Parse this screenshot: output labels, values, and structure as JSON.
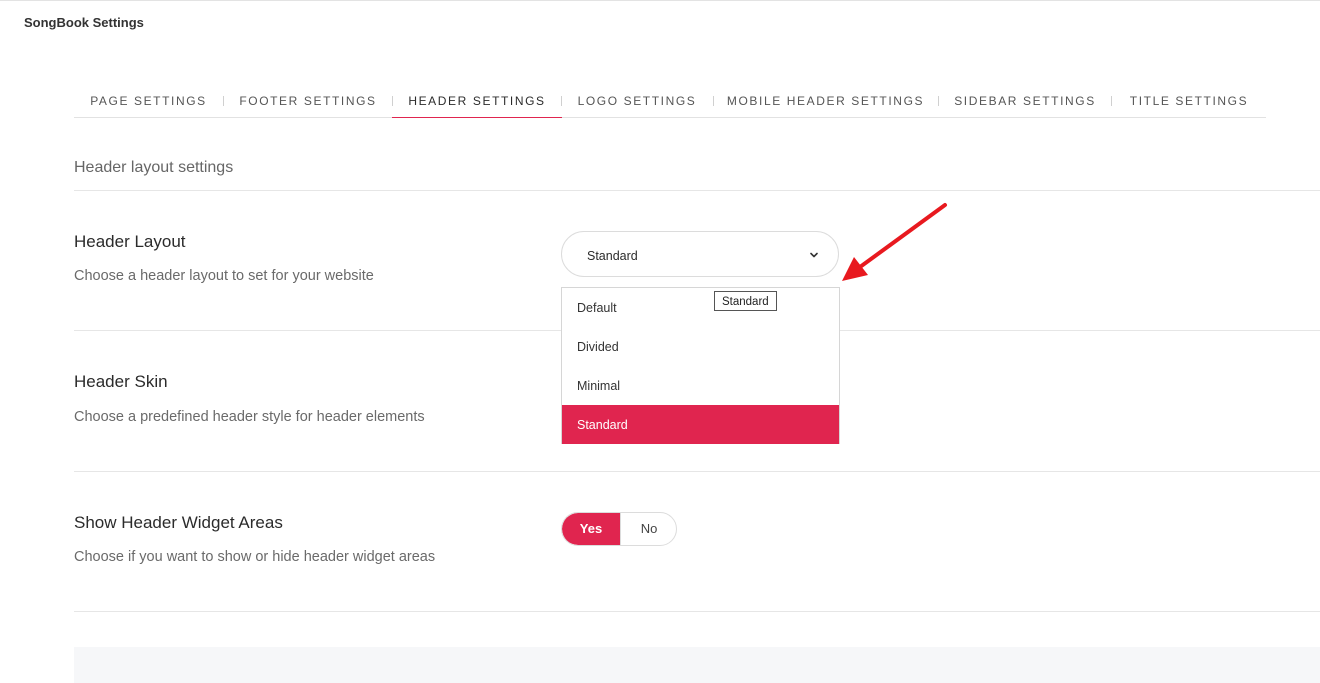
{
  "app": {
    "title": "SongBook Settings"
  },
  "tabs": [
    {
      "label": "PAGE SETTINGS",
      "active": false
    },
    {
      "label": "FOOTER SETTINGS",
      "active": false
    },
    {
      "label": "HEADER SETTINGS",
      "active": true
    },
    {
      "label": "LOGO SETTINGS",
      "active": false
    },
    {
      "label": "MOBILE HEADER SETTINGS",
      "active": false
    },
    {
      "label": "SIDEBAR SETTINGS",
      "active": false
    },
    {
      "label": "TITLE SETTINGS",
      "active": false
    }
  ],
  "section": {
    "title": "Header layout settings"
  },
  "header_layout": {
    "title": "Header Layout",
    "description": "Choose a header layout to set for your website",
    "selected": "Standard",
    "options": [
      "Default",
      "Divided",
      "Minimal",
      "Standard"
    ],
    "tooltip": "Standard"
  },
  "header_skin": {
    "title": "Header Skin",
    "description": "Choose a predefined header style for header elements"
  },
  "widget_areas": {
    "title": "Show Header Widget Areas",
    "description": "Choose if you want to show or hide header widget areas",
    "yes_label": "Yes",
    "no_label": "No",
    "value": "Yes"
  },
  "colors": {
    "accent": "#e0254f",
    "annotation_arrow": "#e8191f"
  },
  "icons": {
    "select_chevron": "chevron-down-icon",
    "annotation": "red-arrow-icon"
  }
}
